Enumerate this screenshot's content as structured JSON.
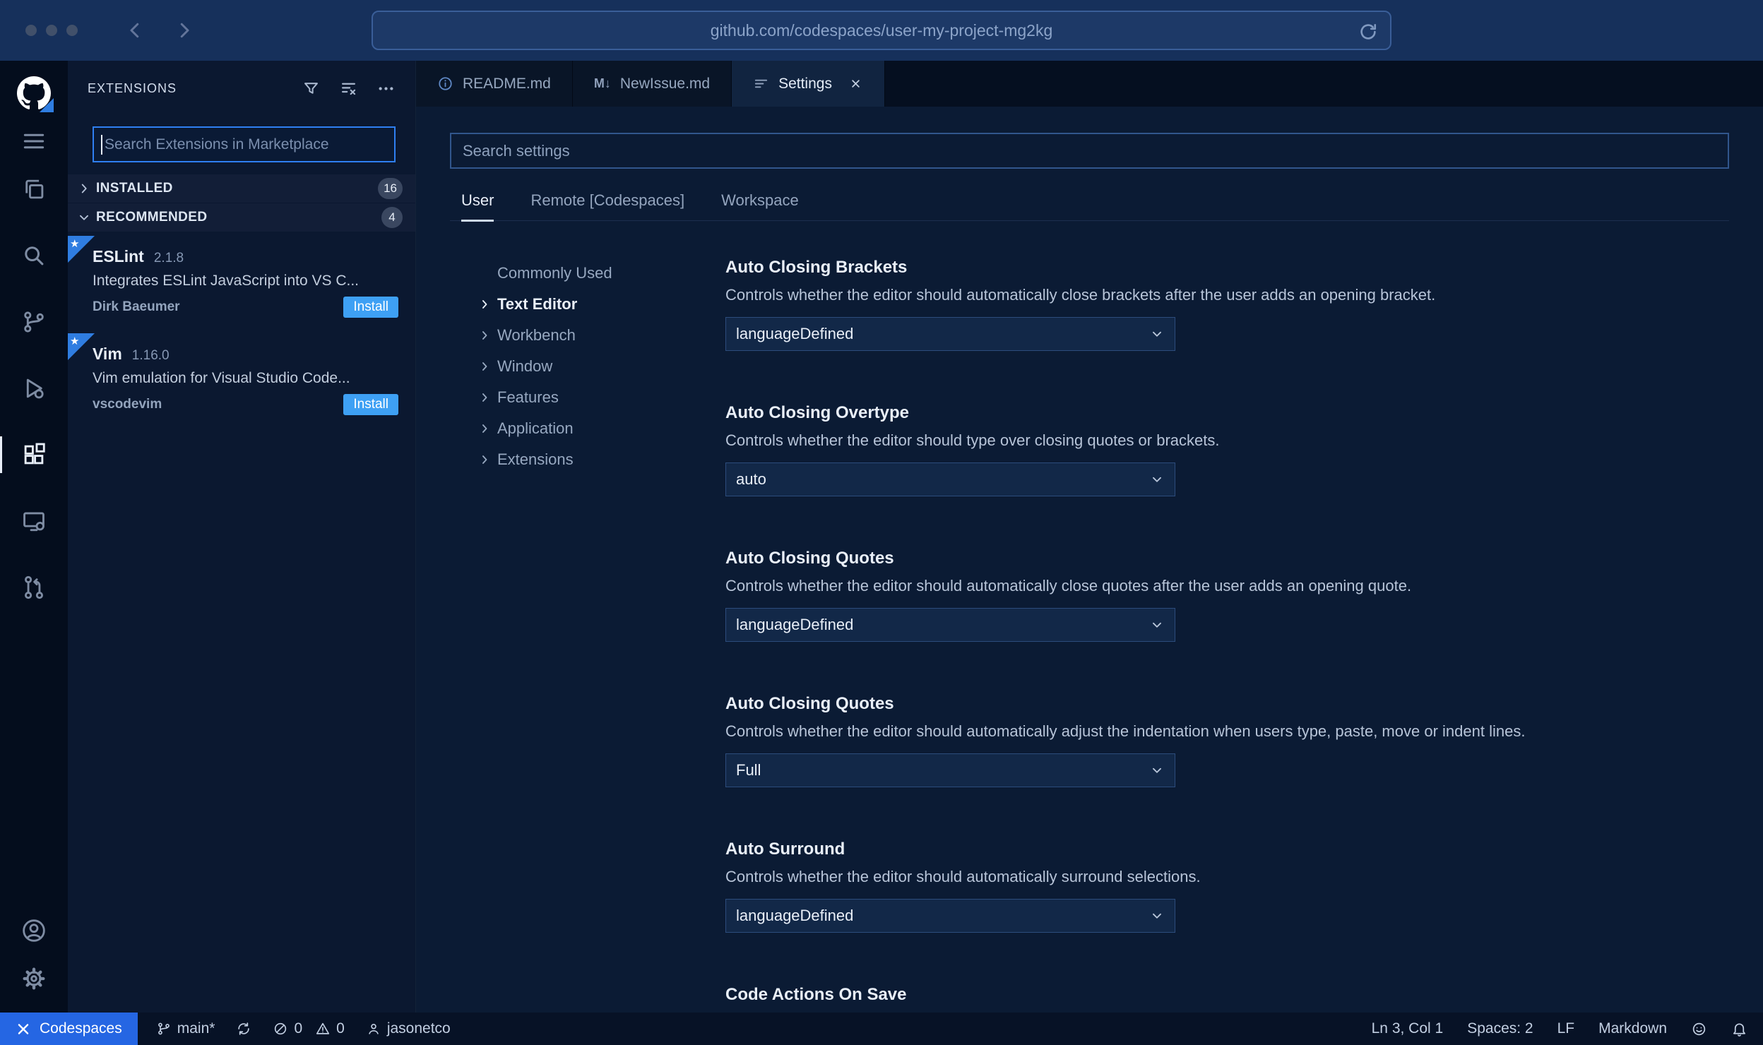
{
  "colors": {
    "accent_blue": "#2f7ff2",
    "install_blue": "#3ea0f4",
    "codespaces_blue": "#2566e3",
    "recommended_flag_blue": "#2f7de1"
  },
  "browser": {
    "url": "github.com/codespaces/user-my-project-mg2kg"
  },
  "sidebar": {
    "title": "EXTENSIONS",
    "search_placeholder": "Search Extensions in Marketplace",
    "sections": [
      {
        "label": "INSTALLED",
        "count": "16"
      },
      {
        "label": "RECOMMENDED",
        "count": "4"
      }
    ],
    "extensions": [
      {
        "name": "ESLint",
        "version": "2.1.8",
        "description": "Integrates ESLint JavaScript into VS C...",
        "author": "Dirk Baeumer",
        "action": "Install"
      },
      {
        "name": "Vim",
        "version": "1.16.0",
        "description": "Vim emulation for Visual Studio Code...",
        "author": "vscodevim",
        "action": "Install"
      }
    ]
  },
  "editor": {
    "tabs": [
      {
        "label": "README.md"
      },
      {
        "label": "NewIssue.md",
        "icon_text": "M↓"
      },
      {
        "label": "Settings"
      }
    ]
  },
  "settings": {
    "search_placeholder": "Search settings",
    "scopes": [
      "User",
      "Remote [Codespaces]",
      "Workspace"
    ],
    "toc": [
      "Commonly Used",
      "Text Editor",
      "Workbench",
      "Window",
      "Features",
      "Application",
      "Extensions"
    ],
    "items": [
      {
        "title": "Auto Closing Brackets",
        "description": "Controls whether the editor should automatically close brackets after the user adds an opening bracket.",
        "value": "languageDefined"
      },
      {
        "title": "Auto Closing Overtype",
        "description": "Controls whether the editor should type over closing quotes or brackets.",
        "value": "auto"
      },
      {
        "title": "Auto Closing Quotes",
        "description": "Controls whether the editor should automatically close quotes after the user adds an opening quote.",
        "value": "languageDefined"
      },
      {
        "title": "Auto Closing Quotes",
        "description": "Controls whether the editor should automatically adjust the indentation when users type, paste, move or indent lines.",
        "value": "Full"
      },
      {
        "title": "Auto Surround",
        "description": "Controls whether the editor should automatically surround selections.",
        "value": "languageDefined"
      },
      {
        "title": "Code Actions On Save",
        "description": "",
        "value": ""
      }
    ]
  },
  "status": {
    "codespaces": "Codespaces",
    "branch": "main*",
    "errors": "0",
    "warnings": "0",
    "user": "jasonetco",
    "right": [
      "Ln 3, Col 1",
      "Spaces: 2",
      "LF",
      "Markdown"
    ]
  }
}
